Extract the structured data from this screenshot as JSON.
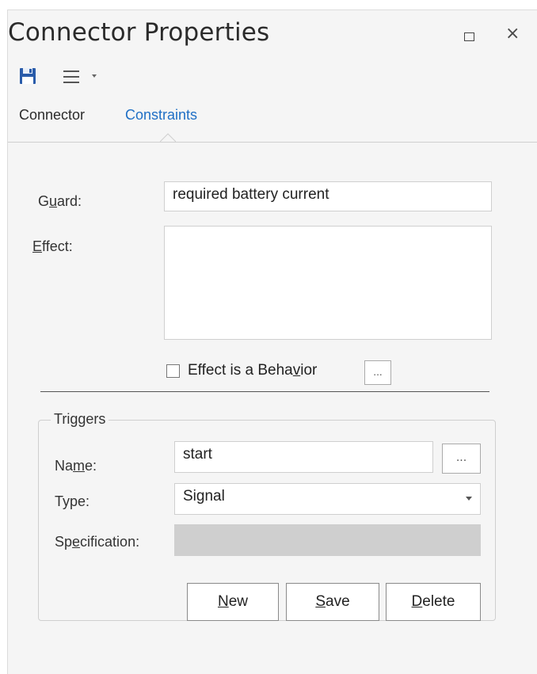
{
  "window": {
    "title": "Connector Properties",
    "maximize_icon": "square-outline-icon",
    "close_glyph": "×"
  },
  "toolbar": {
    "save_icon": "floppy-save-icon",
    "menu_icon": "hamburger-menu-icon",
    "dropdown_icon": "caret-down-icon"
  },
  "tabs": [
    {
      "label": "Connector",
      "active": false
    },
    {
      "label": "Constraints",
      "active": true
    }
  ],
  "form": {
    "guard_label_pre": "G",
    "guard_label_acc": "u",
    "guard_label_post": "ard:",
    "guard_value": "required battery current",
    "effect_label_acc": "E",
    "effect_label_post": "ffect:",
    "effect_value": "",
    "effect_behavior_pre": "Effect is a Beha",
    "effect_behavior_acc": "v",
    "effect_behavior_post": "ior",
    "effect_behavior_checked": false,
    "effect_ellipsis": "..."
  },
  "triggers": {
    "group_title": "Triggers",
    "name_label_pre": "Na",
    "name_label_acc": "m",
    "name_label_post": "e:",
    "name_value": "start",
    "name_ellipsis": "...",
    "type_label": "Type:",
    "type_value": "Signal",
    "spec_label_pre": "Sp",
    "spec_label_acc": "e",
    "spec_label_post": "cification:",
    "spec_value": "",
    "buttons": {
      "new_acc": "N",
      "new_post": "ew",
      "save_acc": "S",
      "save_post": "ave",
      "delete_acc": "D",
      "delete_post": "elete"
    }
  },
  "colors": {
    "active_tab": "#1f6fc5",
    "panel_bg": "#f5f5f5",
    "disabled_field": "#cfcfcf"
  }
}
